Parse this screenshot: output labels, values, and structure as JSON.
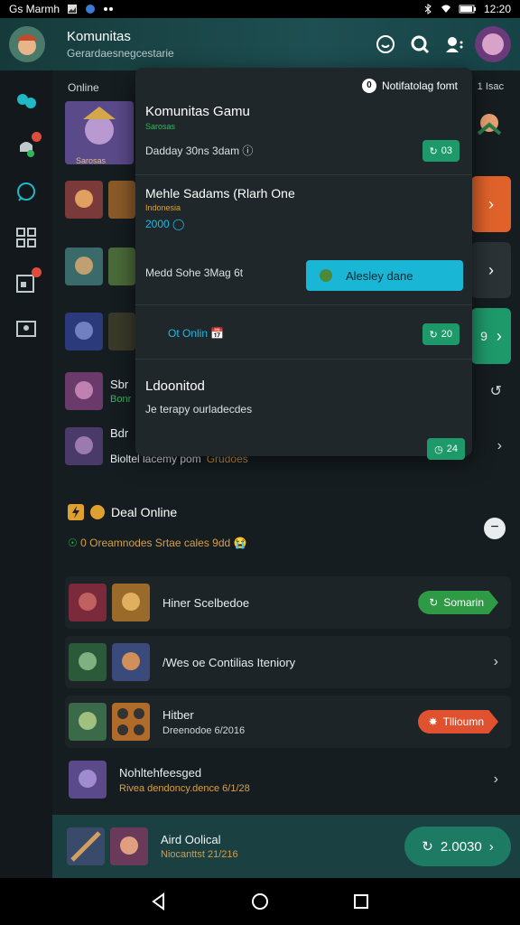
{
  "statusbar": {
    "carrier": "Gs Marmh",
    "time": "12:20"
  },
  "header": {
    "title": "Komunitas",
    "subtitle": "Gerardaesnegcestarie"
  },
  "main": {
    "online_label": "Online",
    "right_label": "1 Isac",
    "rows": [
      {
        "title": "Sbr",
        "subtitle": "Bonr"
      },
      {
        "title": "Bdr",
        "subtitle": ""
      },
      {
        "title": "Bioltel lacemy pom",
        "subtitle": "Grudoes"
      }
    ],
    "row_top_caption": "Sarosas"
  },
  "panel": {
    "notif_icon": "0",
    "notif_label": "Notifatolag fomt",
    "item1_title": "Komunitas Gamu",
    "item1_tag": "Sarosas",
    "item1_sub": "Dadday 30ns 3dam",
    "item1_pill": "03",
    "item2_title": "Mehle Sadams (Rlarh One",
    "item2_tag": "Indonesia",
    "item2_value": "2000",
    "item3_sub": "Medd Sohe 3Mag 6t",
    "item3_button": "Alesley dane",
    "item4_sub": "Ot Onlin",
    "item4_pill": "20",
    "item5_title": "Ldoonitod",
    "item5_sub": "Je terapy ourladecdes",
    "item5_pill": "24"
  },
  "side_buttons": {
    "btn2_value": "9"
  },
  "section": {
    "title": "Deal Online",
    "sub": "0 Oreamnodes Srtae cales 9dd"
  },
  "cards": [
    {
      "label": "Hiner Scelbedoe",
      "sub": "",
      "button": "Somarin",
      "color": "#2f9a45"
    },
    {
      "label": "/Wes oe Contilias Iteniory",
      "sub": "",
      "button": "",
      "color": ""
    },
    {
      "label": "Hitber",
      "sub": "Dreenodoe 6/2016",
      "button": "Tllioumn",
      "color": "#e0522f"
    },
    {
      "label": "Nohltehfeesged",
      "sub": "Rivea dendoncy.dence 6/1/28",
      "button": "",
      "color": ""
    }
  ],
  "bottom": {
    "title": "Aird Oolical",
    "sub": "Niocanttst 21/216",
    "value": "2.0030"
  },
  "colors": {
    "accent_green": "#1e9a6a",
    "accent_cyan": "#1ab6d6",
    "warn_orange": "#e0522f",
    "header_teal": "#1e4f52"
  }
}
